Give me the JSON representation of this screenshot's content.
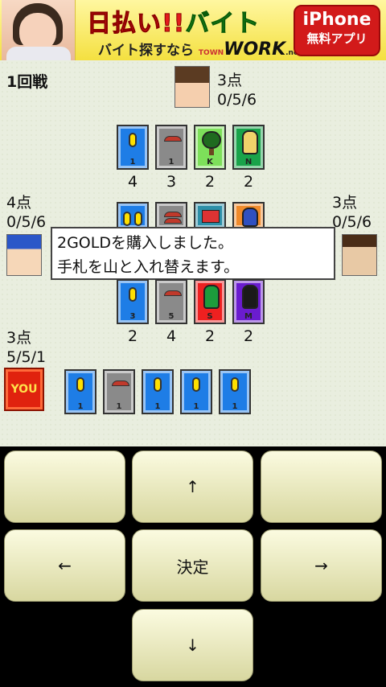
{
  "ad": {
    "headline_red": "日払い!!",
    "headline_green": "バイト",
    "subline": "バイト探すなら",
    "brand_small": "TOWN",
    "brand": "WORK",
    "brand_suffix": ".net",
    "app_line1": "iPhone",
    "app_line2": "無料アプリ"
  },
  "game": {
    "round": "1回戦",
    "message_line1": "2GOLDを購入しました。",
    "message_line2": "手札を山と入れ替えます。",
    "players": {
      "top": {
        "score": "3点",
        "stats": "0/5/6"
      },
      "left": {
        "score": "4点",
        "stats": "0/5/6"
      },
      "right": {
        "score": "3点",
        "stats": "0/5/6"
      },
      "you": {
        "score": "3点",
        "stats": "5/5/1",
        "badge": "YOU"
      }
    },
    "supply_row1": [
      {
        "type": "gold",
        "label": "1",
        "count": "4"
      },
      {
        "type": "house",
        "label": "1",
        "count": "3"
      },
      {
        "type": "tree",
        "label": "K",
        "count": "2"
      },
      {
        "type": "ninja",
        "label": "N",
        "count": "2"
      }
    ],
    "supply_row3": [
      {
        "type": "gold",
        "label": "3",
        "count": "2"
      },
      {
        "type": "house",
        "label": "5",
        "count": "4"
      },
      {
        "type": "samurai",
        "label": "S",
        "count": "2"
      },
      {
        "type": "monster",
        "label": "M",
        "count": "2"
      }
    ],
    "hand": [
      {
        "type": "gold",
        "label": "1"
      },
      {
        "type": "house",
        "label": "1"
      },
      {
        "type": "gold",
        "label": "1"
      },
      {
        "type": "gold",
        "label": "1"
      },
      {
        "type": "gold",
        "label": "1"
      }
    ]
  },
  "controls": {
    "up": "↑",
    "left": "←",
    "ok": "決定",
    "right": "→",
    "down": "↓"
  }
}
